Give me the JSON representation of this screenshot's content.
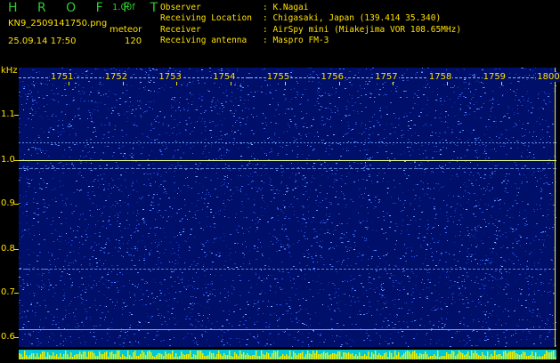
{
  "app": {
    "title": "H R O F F T",
    "version": "1.00f"
  },
  "file": {
    "name": "KN9_2509141750.png",
    "mode": "meteor",
    "datetime": "25.09.14 17:50",
    "count": "120"
  },
  "info": [
    {
      "label": "Observer",
      "value": ": K.Nagai"
    },
    {
      "label": "Receiving Location",
      "value": ": Chigasaki, Japan (139.414 35.340)"
    },
    {
      "label": "Receiver",
      "value": ": AirSpy mini (Miakejima VOR 108.65MHz)"
    },
    {
      "label": "Receiving antenna",
      "value": ": Maspro FM-3"
    }
  ],
  "axis": {
    "y_unit": "kHz",
    "y_ticks": [
      "1.1",
      "1.0",
      "0.9",
      "0.8",
      "0.7",
      "0.6"
    ],
    "x_ticks": [
      "1751",
      "1752",
      "1753",
      "1754",
      "1755",
      "1756",
      "1757",
      "1758",
      "1759",
      "1800"
    ]
  },
  "colors": {
    "text": "#ffe000",
    "title": "#2ecc2e",
    "background": "#00106a",
    "carrier": "#e8ff80"
  }
}
